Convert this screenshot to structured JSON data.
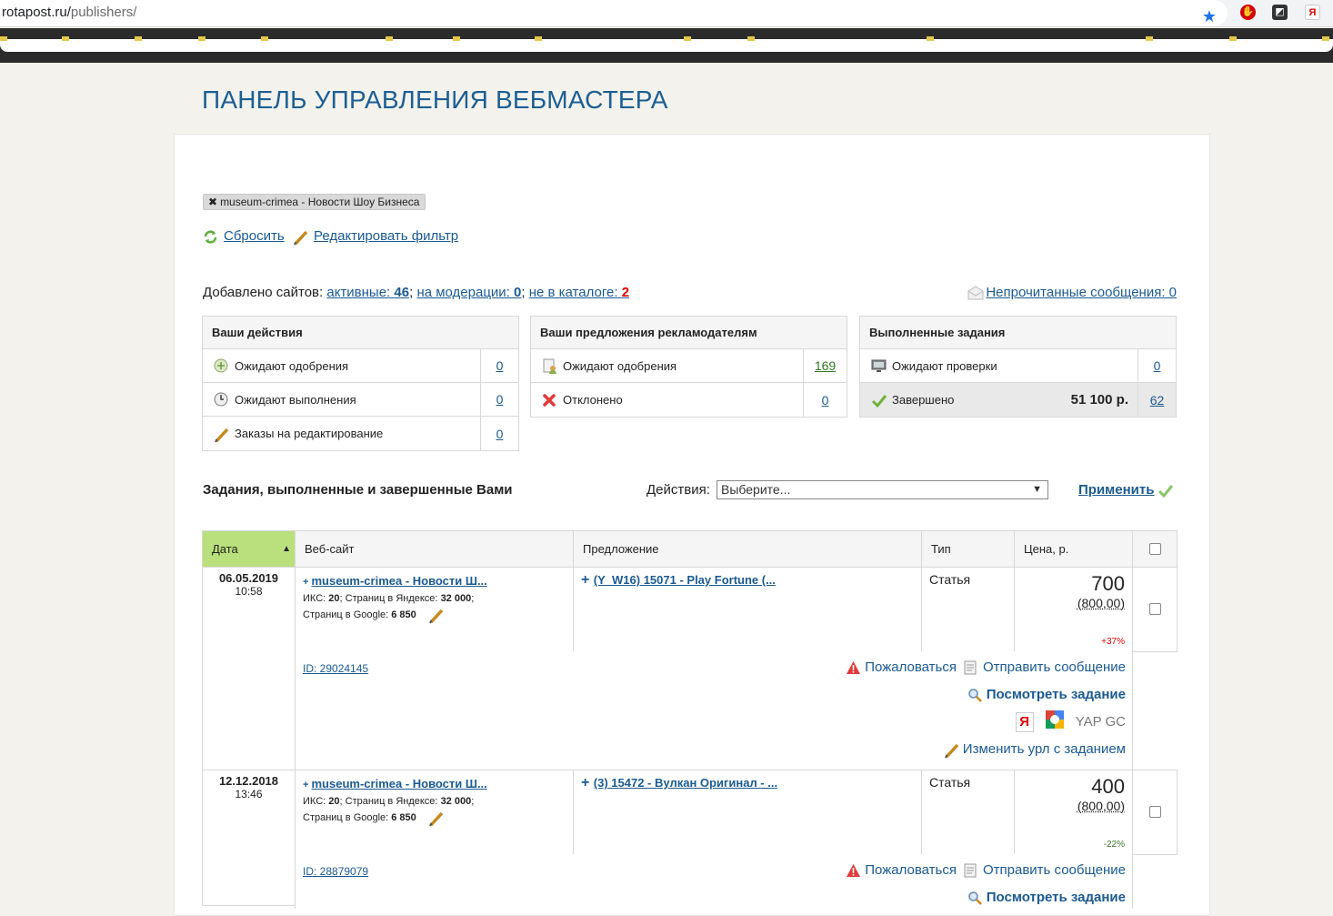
{
  "browser": {
    "url_host": "rotapost.ru/",
    "url_path": "publishers/"
  },
  "page": {
    "title": "ПАНЕЛЬ УПРАВЛЕНИЯ ВЕБМАСТЕРА",
    "filter_tag": "museum-crimea - Новости Шоу Бизнеса",
    "reset_label": "Сбросить",
    "edit_filter_label": "Редактировать фильтр"
  },
  "sites": {
    "prefix": "Добавлено сайтов:",
    "active_label": "активные:",
    "active_count": "46",
    "sep1": ";",
    "moderation_label": "на модерации:",
    "moderation_count": "0",
    "sep2": ";",
    "catalog_label": "не в каталоге:",
    "catalog_count": "2",
    "unread_label": "Непрочитанные сообщения: 0"
  },
  "box_actions": {
    "title": "Ваши действия",
    "rows": [
      {
        "label": "Ожидают одобрения",
        "count": "0"
      },
      {
        "label": "Ожидают выполнения",
        "count": "0"
      },
      {
        "label": "Заказы на редактирование",
        "count": "0"
      }
    ]
  },
  "box_offers": {
    "title": "Ваши предложения рекламодателям",
    "rows": [
      {
        "label": "Ожидают одобрения",
        "count": "169"
      },
      {
        "label": "Отклонено",
        "count": "0"
      }
    ]
  },
  "box_done": {
    "title": "Выполненные задания",
    "rows": [
      {
        "label": "Ожидают проверки",
        "count": "0"
      },
      {
        "label": "Завершено",
        "sum": "51 100 р.",
        "count": "62"
      }
    ]
  },
  "tasks": {
    "title": "Задания, выполненные и завершенные Вами",
    "actions_label": "Действия:",
    "select_value": "Выберите...",
    "apply_label": "Применить",
    "columns": [
      "Дата",
      "Веб-сайт",
      "Предложение",
      "Тип",
      "Цена, р."
    ],
    "rows": [
      {
        "date": "06.05.2019",
        "time": "10:58",
        "site": "museum-crimea - Новости Ш...",
        "iks_label": "ИКС:",
        "iks": "20",
        "yandex_label": "; Страниц в Яндексе:",
        "yandex": "32 000",
        "google_label": "Страниц в Google:",
        "google": "6 850",
        "offer": "(Y_W16) 15071 - Play Fortune (...",
        "type": "Статья",
        "price": "700",
        "price_orig": "(800,00)",
        "pct": "+37%",
        "id": "ID: 29024145",
        "complain": "Пожаловаться",
        "message": "Отправить сообщение",
        "view": "Посмотреть задание",
        "engines": "YAP GC",
        "change_url": "Изменить урл с заданием"
      },
      {
        "date": "12.12.2018",
        "time": "13:46",
        "site": "museum-crimea - Новости Ш...",
        "iks_label": "ИКС:",
        "iks": "20",
        "yandex_label": "; Страниц в Яндексе:",
        "yandex": "32 000",
        "google_label": "Страниц в Google:",
        "google": "6 850",
        "offer": "(3) 15472 - Вулкан Оригинал - ...",
        "type": "Статья",
        "price": "400",
        "price_orig": "(800,00)",
        "pct": "-22%",
        "id": "ID: 28879079",
        "complain": "Пожаловаться",
        "message": "Отправить сообщение",
        "view": "Посмотреть задание"
      }
    ]
  },
  "colors": {
    "title_blue": "#1c5f94",
    "link_blue": "#1a5a92",
    "date_header_green": "#b9e07c",
    "alert_red": "#dd0000"
  }
}
